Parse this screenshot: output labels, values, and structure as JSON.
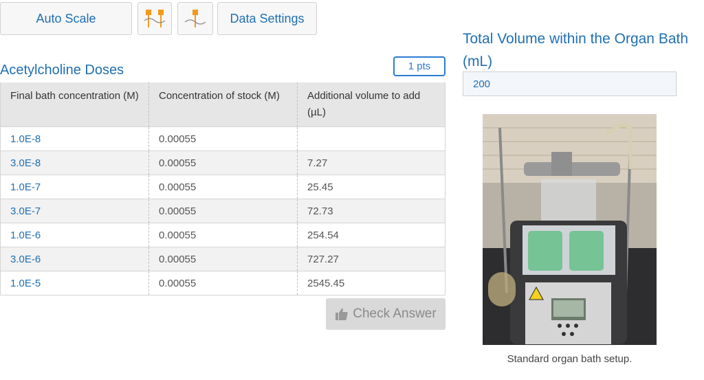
{
  "toolbar": {
    "auto_scale_label": "Auto Scale",
    "data_settings_label": "Data Settings"
  },
  "doses": {
    "title": "Acetylcholine Doses",
    "points": "1 pts",
    "headers": [
      "Final bath concentration (M)",
      "Concentration of stock (M)",
      "Additional volume to add (µL)"
    ],
    "rows": [
      [
        "1.0E-8",
        "0.00055",
        ""
      ],
      [
        "3.0E-8",
        "0.00055",
        "7.27"
      ],
      [
        "1.0E-7",
        "0.00055",
        "25.45"
      ],
      [
        "3.0E-7",
        "0.00055",
        "72.73"
      ],
      [
        "1.0E-6",
        "0.00055",
        "254.54"
      ],
      [
        "3.0E-6",
        "0.00055",
        "727.27"
      ],
      [
        "1.0E-5",
        "0.00055",
        "2545.45"
      ]
    ],
    "check_label": "Check Answer"
  },
  "volume": {
    "title": "Total Volume within the Organ Bath (mL)",
    "value": "200"
  },
  "photo": {
    "caption": "Standard organ bath setup."
  }
}
